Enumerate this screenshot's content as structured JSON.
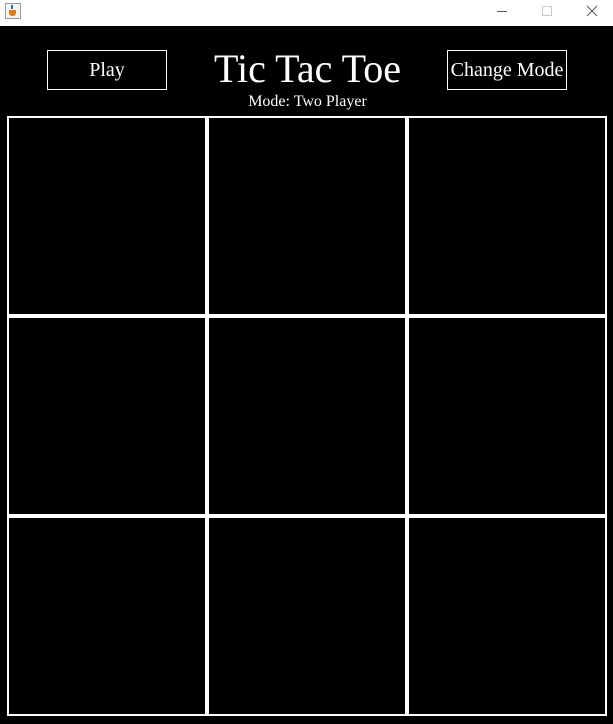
{
  "window": {
    "icon": "java-cup-icon",
    "controls": [
      "minimize-icon",
      "maximize-icon",
      "close-icon"
    ]
  },
  "header": {
    "play_label": "Play",
    "title": "Tic Tac Toe",
    "change_mode_label": "Change Mode",
    "mode_text": "Mode: Two Player"
  },
  "board": {
    "cells": [
      "",
      "",
      "",
      "",
      "",
      "",
      "",
      "",
      ""
    ]
  },
  "colors": {
    "background": "#000000",
    "foreground": "#ffffff"
  }
}
